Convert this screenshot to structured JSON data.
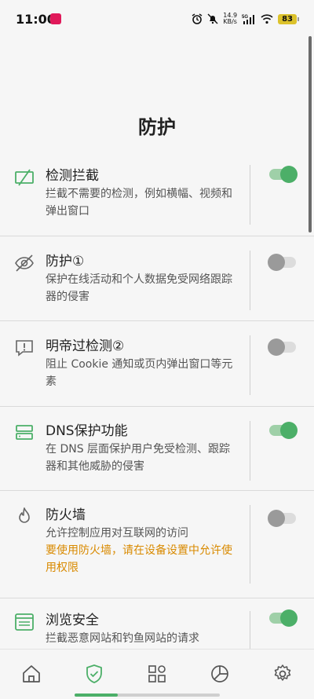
{
  "status_bar": {
    "time": "11:00",
    "net_speed_value": "14.9",
    "net_speed_unit": "KB/s",
    "network": "5G",
    "battery": "83"
  },
  "page": {
    "title": "防护"
  },
  "items": [
    {
      "name": "检测拦截",
      "desc": "拦截不需要的检测，例如横幅、视频和弹出窗口",
      "enabled": true,
      "icon": "blocked-ad-icon"
    },
    {
      "name": "防护①",
      "desc": "保护在线活动和个人数据免受网络跟踪器的侵害",
      "enabled": false,
      "icon": "eye-off-icon"
    },
    {
      "name": "明帝过检测②",
      "desc": "阻止 Cookie 通知或页内弹出窗口等元素",
      "enabled": false,
      "icon": "popup-alert-icon"
    },
    {
      "name": "DNS保护功能",
      "desc": "在 DNS 层面保护用户免受检测、跟踪器和其他威胁的侵害",
      "enabled": true,
      "icon": "dns-server-icon"
    },
    {
      "name": "防火墙",
      "desc": "允许控制应用对互联网的访问",
      "warning": "要使用防火墙，请在设备设置中允许使用权限",
      "enabled": false,
      "icon": "flame-icon"
    },
    {
      "name": "浏览安全",
      "desc": "拦截恶意网站和钓鱼网站的请求",
      "enabled": true,
      "icon": "browser-icon"
    }
  ],
  "bottom_nav": [
    {
      "icon": "home-icon",
      "active": false
    },
    {
      "icon": "shield-check-icon",
      "active": true
    },
    {
      "icon": "apps-grid-icon",
      "active": false
    },
    {
      "icon": "pie-chart-icon",
      "active": false
    },
    {
      "icon": "gear-icon",
      "active": false
    }
  ],
  "colors": {
    "accent": "#4caf68",
    "warning": "#d98a00",
    "toggle_off": "#9a9a9a"
  }
}
